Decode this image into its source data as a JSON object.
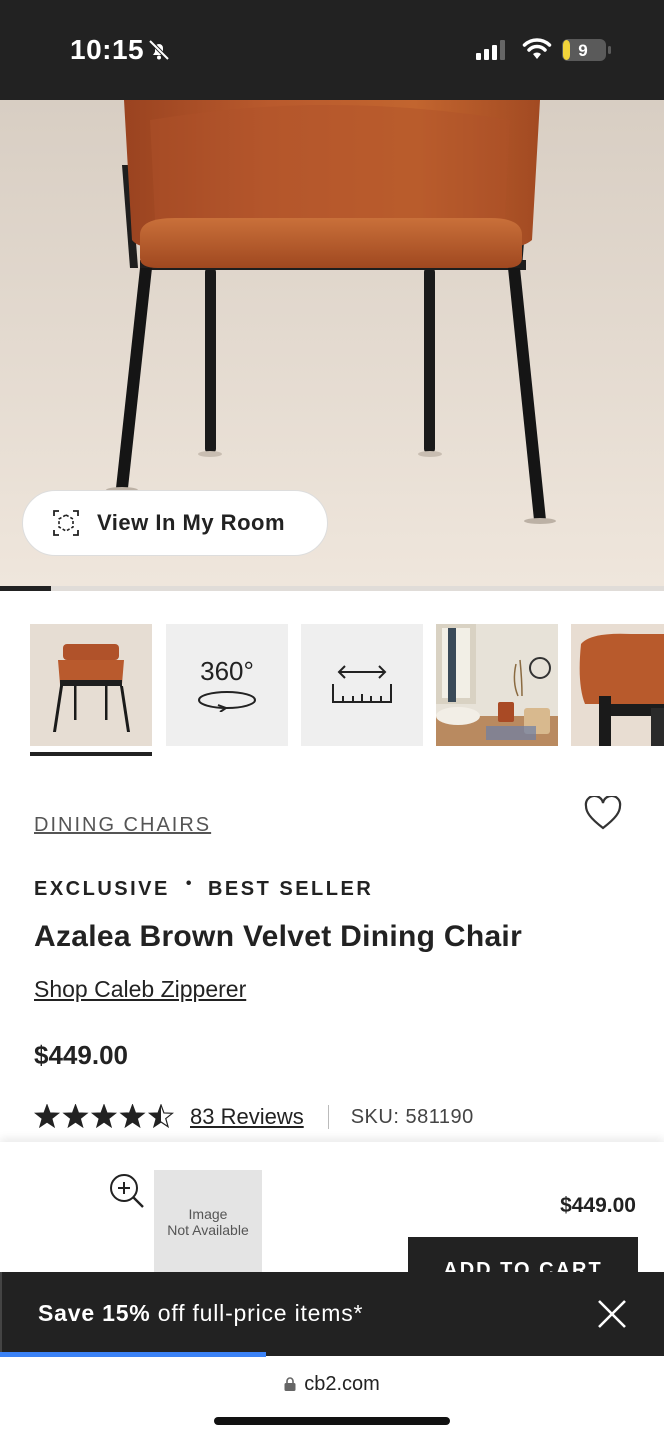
{
  "status_bar": {
    "time": "10:15",
    "battery": "9"
  },
  "hero": {
    "view_in_room_label": "View In My Room",
    "gallery_progress": 0.077
  },
  "thumbnails": [
    {
      "kind": "photo",
      "label": ""
    },
    {
      "kind": "360",
      "label": "360°"
    },
    {
      "kind": "dimensions",
      "label": ""
    },
    {
      "kind": "room-photo",
      "label": ""
    },
    {
      "kind": "detail-photo",
      "label": ""
    }
  ],
  "product": {
    "category": "DINING CHAIRS",
    "tag_exclusive": "EXCLUSIVE",
    "tag_separator": "•",
    "tag_best_seller": "BEST SELLER",
    "title": "Azalea Brown Velvet Dining Chair",
    "designer_link": "Shop Caleb Zipperer",
    "price": "$449.00",
    "rating": 4.5,
    "reviews_label": "83 Reviews",
    "sku": "SKU: 581190"
  },
  "sticky_bar": {
    "image_placeholder_line1": "Image",
    "image_placeholder_line2": "Not Available",
    "price": "$449.00",
    "add_to_cart": "ADD TO CART"
  },
  "promo": {
    "prefix": "Save ",
    "highlight": "15%",
    "suffix": " off full-price items*",
    "progress": 0.4
  },
  "browser": {
    "url": "cb2.com"
  },
  "colors": {
    "dark": "#222222",
    "chair_velvet": "#b5532a",
    "progress_blue": "#3b82f6"
  }
}
